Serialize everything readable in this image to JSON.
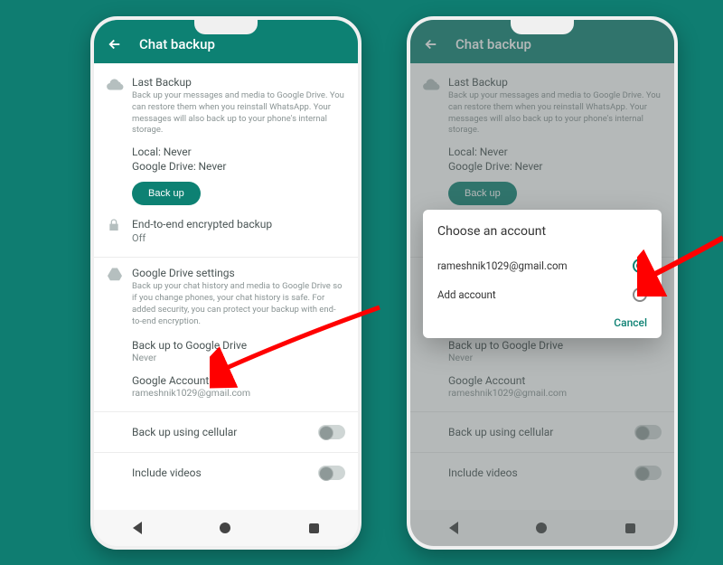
{
  "appbar": {
    "title": "Chat backup"
  },
  "lastBackup": {
    "title": "Last Backup",
    "desc": "Back up your messages and media to Google Drive. You can restore them when you reinstall WhatsApp. Your messages will also back up to your phone's internal storage.",
    "local_label": "Local:",
    "local_value": "Never",
    "drive_label": "Google Drive:",
    "drive_value": "Never",
    "button": "Back up"
  },
  "e2e": {
    "title": "End-to-end encrypted backup",
    "value": "Off"
  },
  "gdrive": {
    "title": "Google Drive settings",
    "desc": "Back up your chat history and media to Google Drive so if you change phones, your chat history is safe. For added security, you can protect your backup with end-to-end encryption.",
    "backup_to_label": "Back up to Google Drive",
    "backup_to_value": "Never",
    "account_label": "Google Account",
    "account_value": "rameshnik1029@gmail.com",
    "cellular_label": "Back up using cellular",
    "videos_label": "Include videos"
  },
  "dialog": {
    "title": "Choose an account",
    "options": [
      {
        "label": "rameshnik1029@gmail.com",
        "selected": true
      },
      {
        "label": "Add account",
        "selected": false
      }
    ],
    "cancel": "Cancel"
  }
}
